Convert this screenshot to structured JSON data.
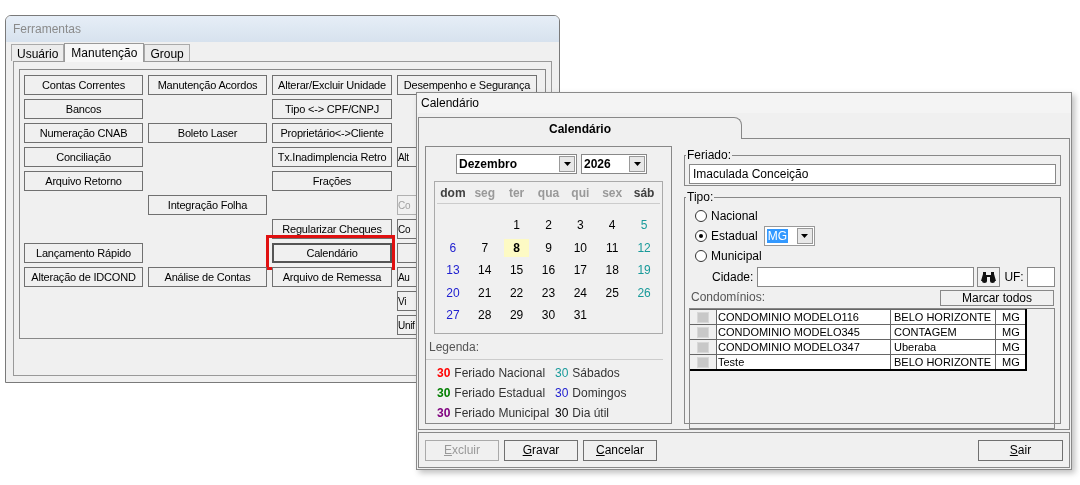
{
  "back_window": {
    "title": "Ferramentas",
    "tabs": [
      {
        "label": "Usuário",
        "selected": false
      },
      {
        "label": "Manutenção",
        "selected": true
      },
      {
        "label": "Group",
        "selected": false
      }
    ],
    "button_rows": [
      [
        {
          "kind": "button",
          "label": "Contas Correntes",
          "disabled": false,
          "highlighted": false
        },
        {
          "kind": "button",
          "label": "Manutenção Acordos",
          "disabled": false,
          "highlighted": false
        },
        {
          "kind": "button",
          "label": "Alterar/Excluir Unidade",
          "disabled": false,
          "highlighted": false
        },
        {
          "kind": "button",
          "label": "Desempenho e Segurança",
          "disabled": false,
          "highlighted": false
        }
      ],
      [
        {
          "kind": "button",
          "label": "Bancos",
          "disabled": false,
          "highlighted": false
        },
        {
          "kind": "empty"
        },
        {
          "kind": "button",
          "label": "Tipo <-> CPF/CNPJ",
          "disabled": false,
          "highlighted": false
        },
        {
          "kind": "empty"
        }
      ],
      [
        {
          "kind": "button",
          "label": "Numeração CNAB",
          "disabled": false,
          "highlighted": false
        },
        {
          "kind": "button",
          "label": "Boleto Laser",
          "disabled": false,
          "highlighted": false
        },
        {
          "kind": "button",
          "label": "Proprietário<->Cliente",
          "disabled": false,
          "highlighted": false
        },
        {
          "kind": "empty"
        }
      ],
      [
        {
          "kind": "button",
          "label": "Conciliação",
          "disabled": false,
          "highlighted": false
        },
        {
          "kind": "empty"
        },
        {
          "kind": "button",
          "label": "Tx.Inadimplencia Retro",
          "disabled": false,
          "highlighted": false
        },
        {
          "kind": "button",
          "label": "Alt",
          "disabled": false,
          "highlighted": false
        }
      ],
      [
        {
          "kind": "button",
          "label": "Arquivo Retorno",
          "disabled": false,
          "highlighted": false
        },
        {
          "kind": "empty"
        },
        {
          "kind": "button",
          "label": "Frações",
          "disabled": false,
          "highlighted": false
        },
        {
          "kind": "empty"
        }
      ],
      [
        {
          "kind": "empty"
        },
        {
          "kind": "button",
          "label": "Integração Folha",
          "disabled": false,
          "highlighted": false
        },
        {
          "kind": "empty"
        },
        {
          "kind": "button",
          "label": "Co",
          "disabled": true,
          "highlighted": false
        }
      ],
      [
        {
          "kind": "empty"
        },
        {
          "kind": "empty"
        },
        {
          "kind": "button",
          "label": "Regularizar Cheques",
          "disabled": false,
          "highlighted": false
        },
        {
          "kind": "button",
          "label": "Co",
          "disabled": false,
          "highlighted": false
        }
      ],
      [
        {
          "kind": "button",
          "label": "Lançamento Rápido",
          "disabled": false,
          "highlighted": false
        },
        {
          "kind": "empty"
        },
        {
          "kind": "button",
          "label": "Calendário",
          "disabled": false,
          "highlighted": true
        },
        {
          "kind": "button",
          "disabled": false,
          "highlighted": false
        }
      ],
      [
        {
          "kind": "button",
          "label": "Alteração de IDCOND",
          "disabled": false,
          "highlighted": false
        },
        {
          "kind": "button",
          "label": "Análise de Contas",
          "disabled": false,
          "highlighted": false
        },
        {
          "kind": "button",
          "label": "Arquivo de Remessa",
          "disabled": false,
          "highlighted": false
        },
        {
          "kind": "button",
          "label": "Au",
          "disabled": false,
          "highlighted": false
        }
      ],
      [
        {
          "kind": "empty"
        },
        {
          "kind": "empty"
        },
        {
          "kind": "empty"
        },
        {
          "kind": "button",
          "label": "Vi",
          "disabled": false,
          "highlighted": false
        }
      ],
      [
        {
          "kind": "empty"
        },
        {
          "kind": "empty"
        },
        {
          "kind": "empty"
        },
        {
          "kind": "button",
          "label": "Unif",
          "disabled": false,
          "highlighted": false
        }
      ]
    ]
  },
  "calendar_window": {
    "title": "Calendário",
    "tabs": [
      {
        "label": "Calendário",
        "selected": true
      }
    ],
    "month": "Dezembro",
    "year": "2026",
    "weekdays": [
      {
        "label": "dom",
        "kind": "weekend"
      },
      {
        "label": "seg",
        "kind": "weekday"
      },
      {
        "label": "ter",
        "kind": "weekday"
      },
      {
        "label": "qua",
        "kind": "weekday"
      },
      {
        "label": "qui",
        "kind": "weekday"
      },
      {
        "label": "sex",
        "kind": "weekday"
      },
      {
        "label": "sáb",
        "kind": "weekend"
      }
    ],
    "weeks": [
      [
        {
          "day": "1",
          "selected": false
        },
        {
          "day": "2",
          "selected": false
        },
        {
          "day": "3",
          "selected": false
        },
        {
          "day": "4",
          "selected": false
        },
        {
          "day": "5",
          "selected": false
        }
      ],
      [
        {
          "day": "6",
          "selected": false
        },
        {
          "day": "7",
          "selected": false
        },
        {
          "day": "8",
          "selected": true
        },
        {
          "day": "9",
          "selected": false
        },
        {
          "day": "10",
          "selected": false
        },
        {
          "day": "11",
          "selected": false
        },
        {
          "day": "12",
          "selected": false
        }
      ],
      [
        {
          "day": "13",
          "selected": false
        },
        {
          "day": "14",
          "selected": false
        },
        {
          "day": "15",
          "selected": false
        },
        {
          "day": "16",
          "selected": false
        },
        {
          "day": "17",
          "selected": false
        },
        {
          "day": "18",
          "selected": false
        },
        {
          "day": "19",
          "selected": false
        }
      ],
      [
        {
          "day": "20",
          "selected": false
        },
        {
          "day": "21",
          "selected": false
        },
        {
          "day": "22",
          "selected": false
        },
        {
          "day": "23",
          "selected": false
        },
        {
          "day": "24",
          "selected": false
        },
        {
          "day": "25",
          "selected": false
        },
        {
          "day": "26",
          "selected": false
        }
      ],
      [
        {
          "day": "27",
          "selected": false
        },
        {
          "day": "28",
          "selected": false
        },
        {
          "day": "29",
          "selected": false
        },
        {
          "day": "30",
          "selected": false
        },
        {
          "day": "31",
          "selected": false
        }
      ]
    ],
    "legend_title": "Legenda:",
    "legend": [
      {
        "sample": "30",
        "label": "Feriado Nacional",
        "color": "#ff0000",
        "kind": "holiday"
      },
      {
        "sample": "30",
        "label": "Sábados",
        "color": "#189a9a",
        "kind": "day"
      },
      {
        "sample": "30",
        "label": "Feriado Estadual",
        "color": "#008000",
        "kind": "holiday"
      },
      {
        "sample": "30",
        "label": "Domingos",
        "color": "#2020d0",
        "kind": "day"
      },
      {
        "sample": "30",
        "label": "Feriado Municipal",
        "color": "#800080",
        "kind": "holiday"
      },
      {
        "sample": "30",
        "label": "Dia útil",
        "color": "#000000",
        "kind": "day"
      }
    ],
    "holiday": {
      "label": "Feriado:",
      "value": "Imaculada Conceição"
    },
    "type": {
      "label": "Tipo:",
      "options": [
        {
          "label": "Nacional",
          "selected": false
        },
        {
          "label": "Estadual",
          "selected": true
        },
        {
          "label": "Municipal",
          "selected": false
        }
      ],
      "state_value": "MG",
      "city_label": "Cidade:",
      "uf_label": "UF:"
    },
    "mark_all": "Marcar todos",
    "condos_label": "Condomínios:",
    "condos": [
      {
        "checked": false,
        "name": "CONDOMINIO MODELO116",
        "city": "BELO HORIZONTE",
        "uf": "MG"
      },
      {
        "checked": false,
        "name": "CONDOMINIO MODELO345",
        "city": "CONTAGEM",
        "uf": "MG"
      },
      {
        "checked": false,
        "name": "CONDOMINIO MODELO347",
        "city": "Uberaba",
        "uf": "MG"
      },
      {
        "checked": false,
        "name": "Teste",
        "city": "BELO HORIZONTE",
        "uf": "MG"
      }
    ],
    "buttons": [
      {
        "label": "Excluir",
        "disabled": true
      },
      {
        "label": "Gravar",
        "disabled": false
      },
      {
        "label": "Cancelar",
        "disabled": false
      }
    ],
    "close_button": {
      "label": "Sair",
      "disabled": false
    }
  }
}
